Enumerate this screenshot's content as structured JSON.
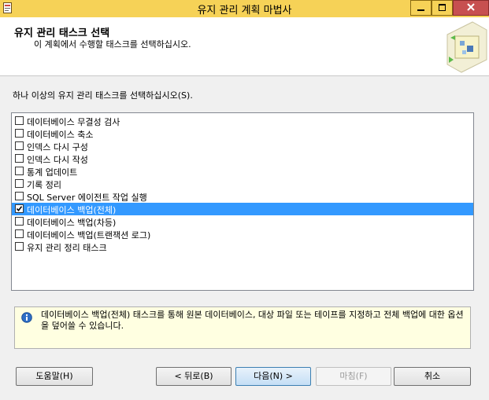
{
  "window": {
    "title": "유지 관리 계획 마법사"
  },
  "header": {
    "title": "유지 관리 태스크 선택",
    "subtitle": "이 계획에서 수행할 태스크를 선택하십시오."
  },
  "prompt": "하나 이상의 유지 관리 태스크를 선택하십시오(S).",
  "tasks": [
    {
      "label": "데이터베이스 무결성 검사",
      "checked": false,
      "selected": false
    },
    {
      "label": "데이터베이스 축소",
      "checked": false,
      "selected": false
    },
    {
      "label": "인덱스 다시 구성",
      "checked": false,
      "selected": false
    },
    {
      "label": "인덱스 다시 작성",
      "checked": false,
      "selected": false
    },
    {
      "label": "통계 업데이트",
      "checked": false,
      "selected": false
    },
    {
      "label": "기록 정리",
      "checked": false,
      "selected": false
    },
    {
      "label": "SQL Server 에이전트 작업 실행",
      "checked": false,
      "selected": false
    },
    {
      "label": "데이터베이스 백업(전체)",
      "checked": true,
      "selected": true
    },
    {
      "label": "데이터베이스 백업(차등)",
      "checked": false,
      "selected": false
    },
    {
      "label": "데이터베이스 백업(트랜잭션 로그)",
      "checked": false,
      "selected": false
    },
    {
      "label": "유지 관리 정리 태스크",
      "checked": false,
      "selected": false
    }
  ],
  "description": "데이터베이스 백업(전체) 태스크를 통해 원본 데이터베이스, 대상 파일 또는 테이프를 지정하고 전체 백업에 대한 옵션을 덮어쓸 수 있습니다.",
  "buttons": {
    "help": "도움말(H)",
    "back": "< 뒤로(B)",
    "next": "다음(N) >",
    "finish": "마침(F)",
    "cancel": "취소"
  },
  "colors": {
    "titlebar": "#f6d257",
    "selection": "#3399ff",
    "info_bg": "#ffffe1"
  }
}
